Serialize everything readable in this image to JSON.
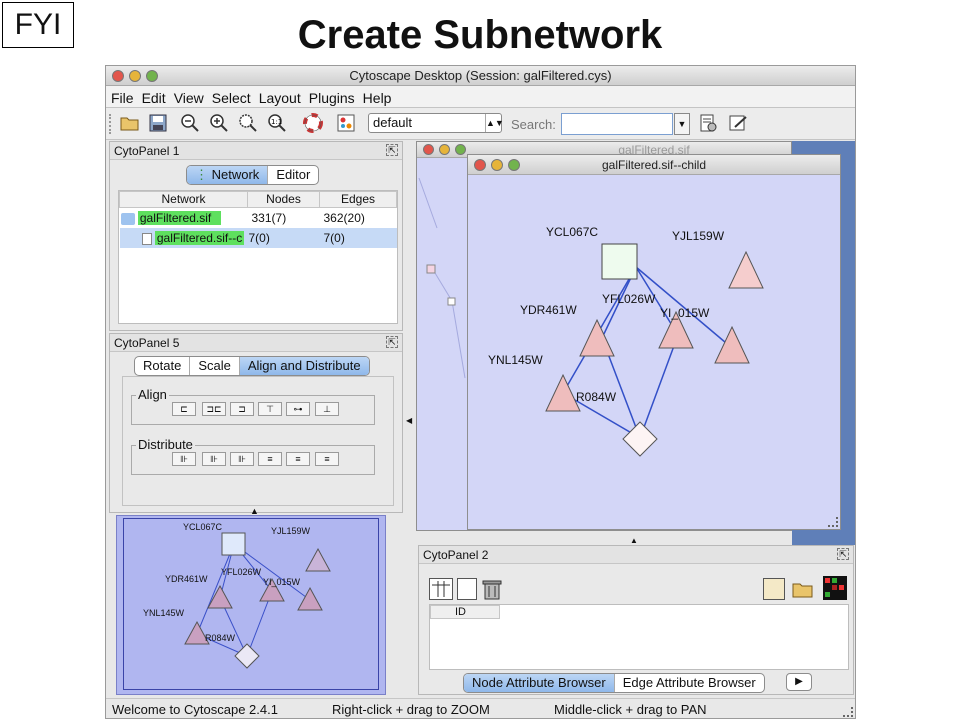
{
  "slide": {
    "badge": "FYI",
    "title": "Create Subnetwork"
  },
  "window": {
    "title": "Cytoscape Desktop (Session: galFiltered.cys)"
  },
  "menu": [
    "File",
    "Edit",
    "View",
    "Select",
    "Layout",
    "Plugins",
    "Help"
  ],
  "toolbar": {
    "layout_value": "default",
    "search_label": "Search:",
    "search_value": ""
  },
  "cytopanel1": {
    "title": "CytoPanel 1",
    "tabs": [
      "Network",
      "Editor"
    ],
    "selected_tab": "Network",
    "columns": [
      "Network",
      "Nodes",
      "Edges"
    ],
    "rows": [
      {
        "name": "galFiltered.sif",
        "nodes": "331(7)",
        "edges": "362(20)"
      },
      {
        "name": "galFiltered.sif--c",
        "nodes": "7(0)",
        "edges": "7(0)"
      }
    ]
  },
  "cytopanel5": {
    "title": "CytoPanel 5",
    "tabs": [
      "Rotate",
      "Scale",
      "Align and Distribute"
    ],
    "selected_tab": "Align and Distribute",
    "align_label": "Align",
    "distribute_label": "Distribute"
  },
  "parent_window": {
    "title": "galFiltered.sif"
  },
  "child_window": {
    "title": "galFiltered.sif--child",
    "nodes": {
      "YCL067C": "YCL067C",
      "YJL159W": "YJL159W",
      "YDR461W": "YDR461W",
      "YFL026W": "YFL026W",
      "YIL015W": "YI_015W",
      "YNL145W": "YNL145W",
      "YKR084W": "R084W"
    }
  },
  "cytopanel2": {
    "title": "CytoPanel 2",
    "column_header": "ID",
    "tabs": [
      "Node Attribute Browser",
      "Edge Attribute Browser"
    ],
    "selected_tab": "Node Attribute Browser"
  },
  "status": {
    "welcome": "Welcome to Cytoscape 2.4.1",
    "zoom_hint": "Right-click + drag  to  ZOOM",
    "pan_hint": "Middle-click + drag  to  PAN"
  },
  "colors": {
    "canvas": "#d3d6f7",
    "edge": "#3350c8",
    "triangle_fill": "#f1c5c5",
    "selection_green": "#5ee05e"
  }
}
